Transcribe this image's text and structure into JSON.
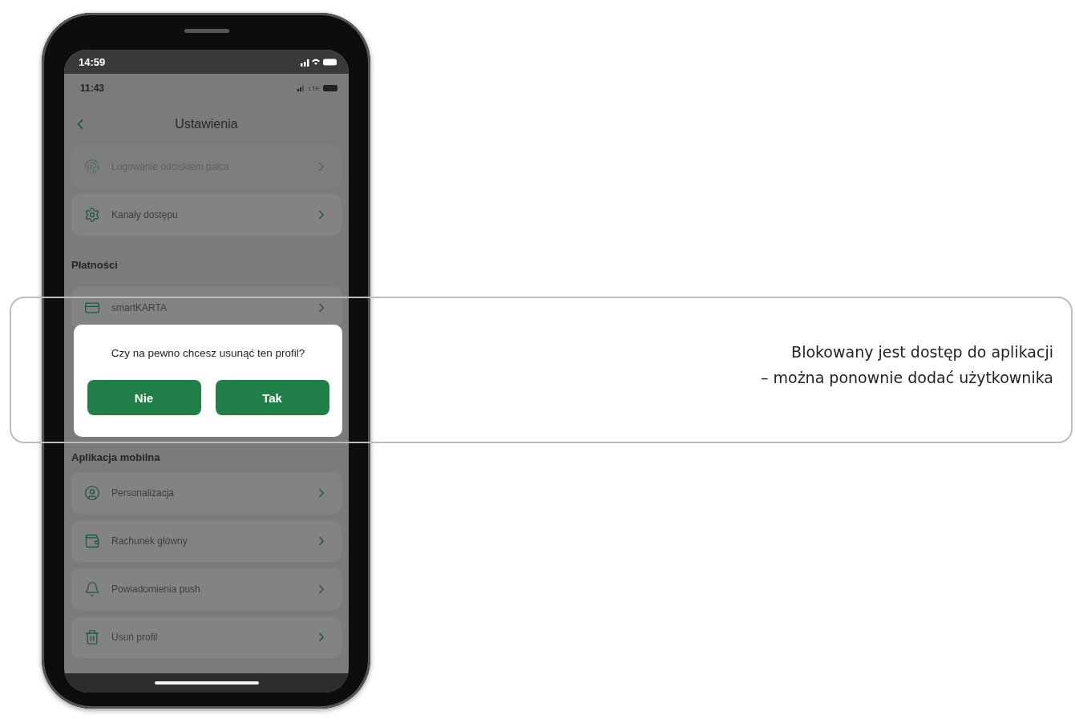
{
  "phone": {
    "outer_status": {
      "time": "14:59"
    },
    "inner_status": {
      "time": "11:43",
      "network": "LTE"
    },
    "header": {
      "title": "Ustawienia"
    },
    "sections": [
      {
        "items": [
          {
            "label": "Logowanie odciskiem palca",
            "disabled": true
          },
          {
            "label": "Kanały dostępu",
            "disabled": false
          }
        ]
      },
      {
        "title": "Płatności",
        "items": [
          {
            "label": "smartKARTA",
            "disabled": false
          }
        ]
      },
      {
        "title": "Aplikacja mobilna",
        "items": [
          {
            "label": "Personalizacja",
            "disabled": false
          },
          {
            "label": "Rachunek główny",
            "disabled": false
          },
          {
            "label": "Powiadomienia push",
            "disabled": false
          },
          {
            "label": "Usuń profil",
            "disabled": false
          }
        ]
      }
    ],
    "dialog": {
      "question": "Czy na pewno chcesz usunąć ten profil?",
      "buttons": [
        "Nie",
        "Tak"
      ]
    }
  },
  "callout": {
    "lines": [
      "Blokowany jest dostęp do aplikacji",
      "– można ponownie dodać użytkownika"
    ]
  }
}
